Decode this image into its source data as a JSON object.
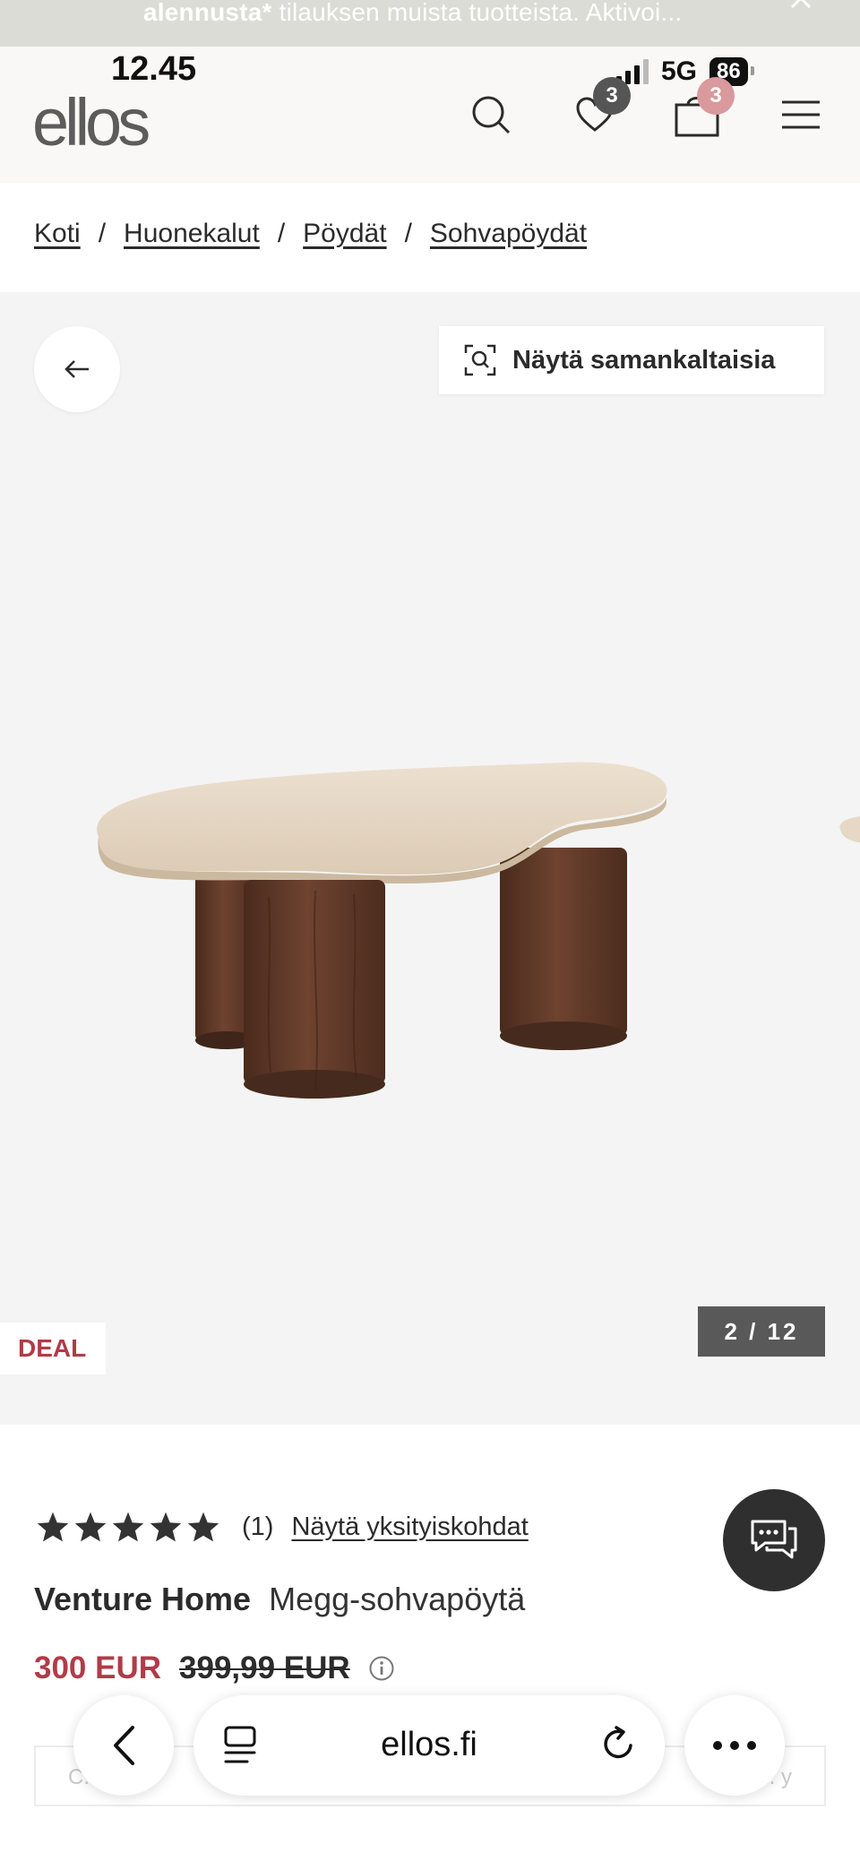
{
  "promo": {
    "bold_text": "alennusta*",
    "text": " tilauksen muista tuotteista. Aktivoi..."
  },
  "status_bar": {
    "time": "12.45",
    "network": "5G",
    "battery": "86"
  },
  "header": {
    "logo": "ellos",
    "wishlist_count": "3",
    "cart_count": "3"
  },
  "breadcrumb": [
    {
      "label": "Koti"
    },
    {
      "label": "Huonekalut"
    },
    {
      "label": "Pöydät"
    },
    {
      "label": "Sohvapöydät"
    }
  ],
  "gallery": {
    "similar_label": "Näytä samankaltaisia",
    "deal_label": "DEAL",
    "counter": "2 / 12"
  },
  "product": {
    "rating_stars": 5,
    "rating_count": "(1)",
    "rating_link": "Näytä yksityiskohdat",
    "brand": "Venture Home",
    "name": "Megg-sohvapöytä",
    "price": "300 EUR",
    "old_price": "399,99 EUR"
  },
  "ghost_input": {
    "left_text": "C... , m",
    "right_text": "ello... y"
  },
  "browser": {
    "url": "ellos.fi"
  },
  "colors": {
    "deal_red": "#b23a48",
    "badge_grey": "#555555",
    "badge_rose": "#d9999d",
    "gallery_bg": "#f4f4f4"
  }
}
